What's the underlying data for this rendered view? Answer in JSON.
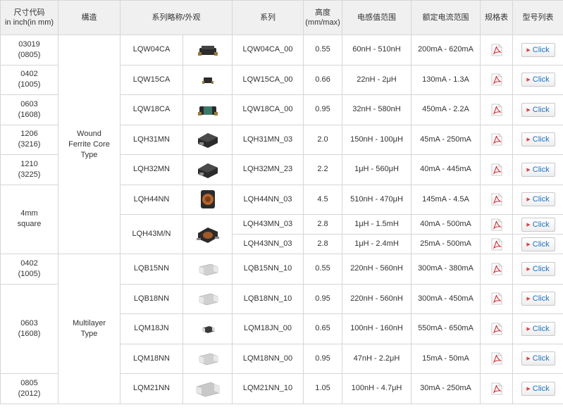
{
  "headers": {
    "size": [
      "尺寸代码",
      "in inch(in mm)"
    ],
    "structure": "構造",
    "series_name": "系列略称/外观",
    "series": "系列",
    "height": [
      "高度",
      "(mm/max)"
    ],
    "inductance": "电感值范围",
    "current": "额定电流范围",
    "spec_sheet": "规格表",
    "model_list": "型号列表"
  },
  "structures": {
    "wound": [
      "Wound",
      "Ferrite Core",
      "Type"
    ],
    "multilayer": [
      "Multilayer",
      "Type"
    ]
  },
  "sizes": {
    "s03019": [
      "03019",
      "(0805)"
    ],
    "s0402a": [
      "0402",
      "(1005)"
    ],
    "s0603a": [
      "0603",
      "(1608)"
    ],
    "s1206": [
      "1206",
      "(3216)"
    ],
    "s1210": [
      "1210",
      "(3225)"
    ],
    "s4mm": [
      "4mm",
      "square"
    ],
    "s0402b": [
      "0402",
      "(1005)"
    ],
    "s0603b": [
      "0603",
      "(1608)"
    ],
    "s0805": [
      "0805",
      "(2012)"
    ]
  },
  "click_label": "Click",
  "rows": [
    {
      "name": "LQW04CA",
      "series": "LQW04CA_00",
      "height": "0.55",
      "inductance": "60nH - 510nH",
      "current": "200mA - 620mA",
      "icon": "wire-wound-chip-small"
    },
    {
      "name": "LQW15CA",
      "series": "LQW15CA_00",
      "height": "0.66",
      "inductance": "22nH - 2μH",
      "current": "130mA - 1.3A",
      "icon": "wire-wound-chip-tiny"
    },
    {
      "name": "LQW18CA",
      "series": "LQW18CA_00",
      "height": "0.95",
      "inductance": "32nH - 580nH",
      "current": "450mA - 2.2A",
      "icon": "wire-wound-chip-green"
    },
    {
      "name": "LQH31MN",
      "series": "LQH31MN_03",
      "height": "2.0",
      "inductance": "150nH - 100μH",
      "current": "45mA - 250mA",
      "icon": "ferrite-inductor-dark"
    },
    {
      "name": "LQH32MN",
      "series": "LQH32MN_23",
      "height": "2.2",
      "inductance": "1μH - 560μH",
      "current": "40mA - 445mA",
      "icon": "ferrite-inductor-dark"
    },
    {
      "name": "LQH44NN",
      "series": "LQH44NN_03",
      "height": "4.5",
      "inductance": "510nH - 470μH",
      "current": "145mA - 4.5A",
      "icon": "ferrite-inductor-copper"
    },
    {
      "name": "LQH43M/N",
      "series": "LQH43MN_03",
      "height": "2.8",
      "inductance": "1μH - 1.5mH",
      "current": "40mA - 500mA",
      "icon": "ferrite-inductor-leaded"
    },
    {
      "name": "",
      "series": "LQH43NN_03",
      "height": "2.8",
      "inductance": "1μH - 2.4mH",
      "current": "25mA - 500mA",
      "icon": ""
    },
    {
      "name": "LQB15NN",
      "series": "LQB15NN_10",
      "height": "0.55",
      "inductance": "220nH - 560nH",
      "current": "300mA - 380mA",
      "icon": "multilayer-chip"
    },
    {
      "name": "LQB18NN",
      "series": "LQB18NN_10",
      "height": "0.95",
      "inductance": "220nH - 560nH",
      "current": "300mA - 450mA",
      "icon": "multilayer-chip"
    },
    {
      "name": "LQM18JN",
      "series": "LQM18JN_00",
      "height": "0.65",
      "inductance": "100nH - 160nH",
      "current": "550mA - 650mA",
      "icon": "multilayer-chip-flat"
    },
    {
      "name": "LQM18NN",
      "series": "LQM18NN_00",
      "height": "0.95",
      "inductance": "47nH - 2.2μH",
      "current": "15mA - 50mA",
      "icon": "multilayer-chip"
    },
    {
      "name": "LQM21NN",
      "series": "LQM21NN_10",
      "height": "1.05",
      "inductance": "100nH - 4.7μH",
      "current": "30mA - 250mA",
      "icon": "multilayer-chip-large"
    }
  ],
  "colors": {
    "link": "#1a70c8",
    "pdf_red": "#d9272e",
    "header_bg": "#f0f0f0",
    "border": "#d6d6d6"
  }
}
